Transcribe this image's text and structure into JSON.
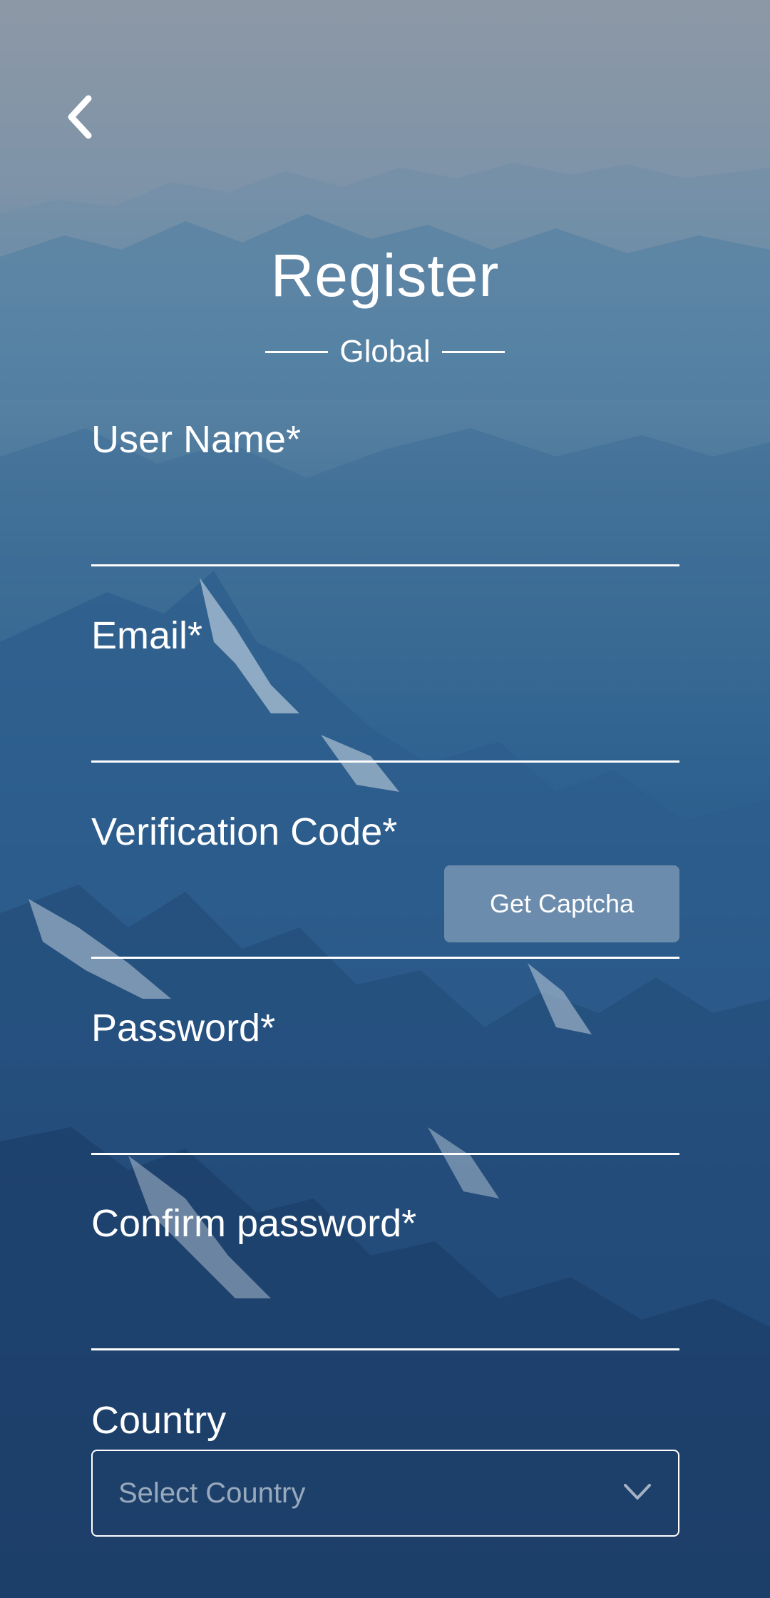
{
  "header": {
    "back_icon": "chevron-left-icon",
    "title": "Register",
    "subtitle": "Global"
  },
  "form": {
    "username": {
      "label": "User Name*",
      "value": ""
    },
    "email": {
      "label": "Email*",
      "value": ""
    },
    "verification": {
      "label": "Verification Code*",
      "value": "",
      "button_label": "Get Captcha"
    },
    "password": {
      "label": "Password*",
      "value": ""
    },
    "confirm_password": {
      "label": "Confirm password*",
      "value": ""
    },
    "country": {
      "label": "Country",
      "placeholder": "Select Country",
      "icon": "chevron-down-icon"
    }
  },
  "colors": {
    "text": "#ffffff",
    "captcha_button_bg": "rgba(160,180,200,0.55)"
  }
}
